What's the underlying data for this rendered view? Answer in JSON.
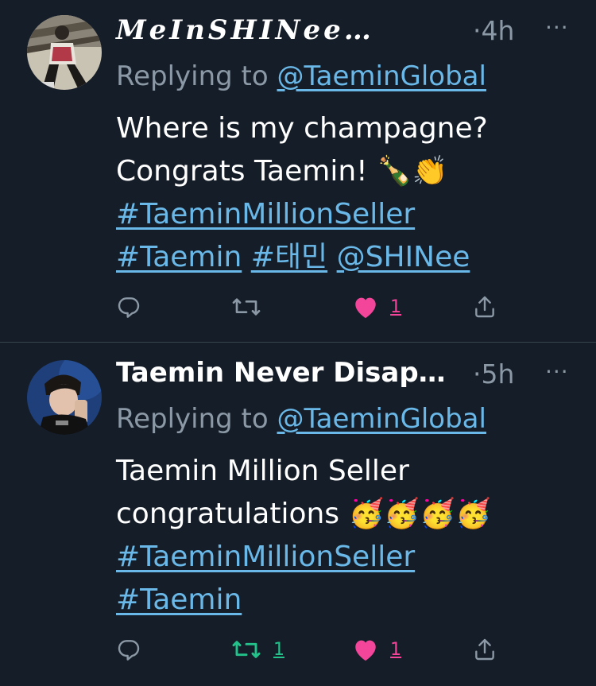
{
  "tweets": [
    {
      "display_name": "𝑴𝒆𝑰𝒏𝑺𝑯𝑰𝑵𝒆𝒆…",
      "time": "·4h",
      "more": "···",
      "replying_prefix": "Replying to",
      "replying_handle": "@TaeminGlobal",
      "line1": "Where is my champagne?",
      "line2": "Congrats Taemin! 🍾👏",
      "line3_tag1": "#TaeminMillionSeller",
      "line4_tag1": "#Taemin",
      "line4_tag2": "#태민",
      "line4_tag3": "@SHINee",
      "retweet_count": "",
      "like_count": "1",
      "liked": true,
      "retweeted": false
    },
    {
      "display_name": "Taemin Never Disap…",
      "time": "·5h",
      "more": "···",
      "replying_prefix": "Replying to",
      "replying_handle": "@TaeminGlobal",
      "line1": "Taemin Million Seller",
      "line2": "congratulations 🥳🥳🥳🥳",
      "line3_tag1": "#TaeminMillionSeller",
      "line4_tag1": "#Taemin",
      "retweet_count": "1",
      "like_count": "1",
      "liked": true,
      "retweeted": true
    }
  ],
  "colors": {
    "background": "#151d28",
    "link": "#6ab8e8",
    "muted": "#8b98a5",
    "like": "#f3459a",
    "retweet": "#23c28a",
    "divider": "#38444d"
  },
  "icons": [
    "reply-icon",
    "retweet-icon",
    "like-icon",
    "share-icon",
    "more-icon"
  ]
}
